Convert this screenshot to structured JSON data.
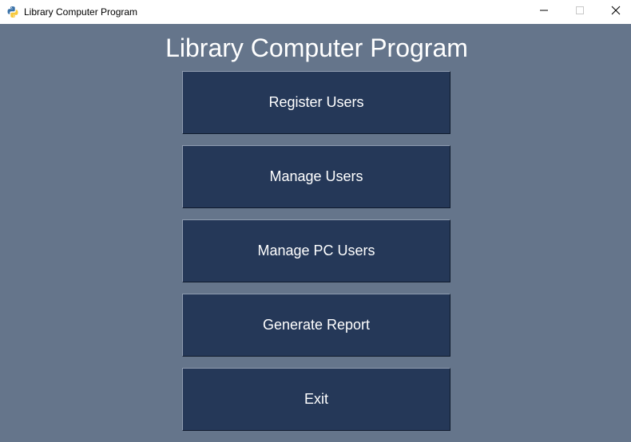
{
  "window": {
    "title": "Library Computer Program",
    "icon": "python-icon",
    "controls": [
      "minimize-icon",
      "maximize-icon",
      "close-icon"
    ]
  },
  "main": {
    "heading": "Library Computer Program",
    "buttons": [
      {
        "label": "Register Users"
      },
      {
        "label": "Manage Users"
      },
      {
        "label": "Manage PC Users"
      },
      {
        "label": "Generate Report"
      },
      {
        "label": "Exit"
      }
    ]
  },
  "colors": {
    "background": "#65758b",
    "button": "#253858",
    "text": "#ffffff"
  }
}
